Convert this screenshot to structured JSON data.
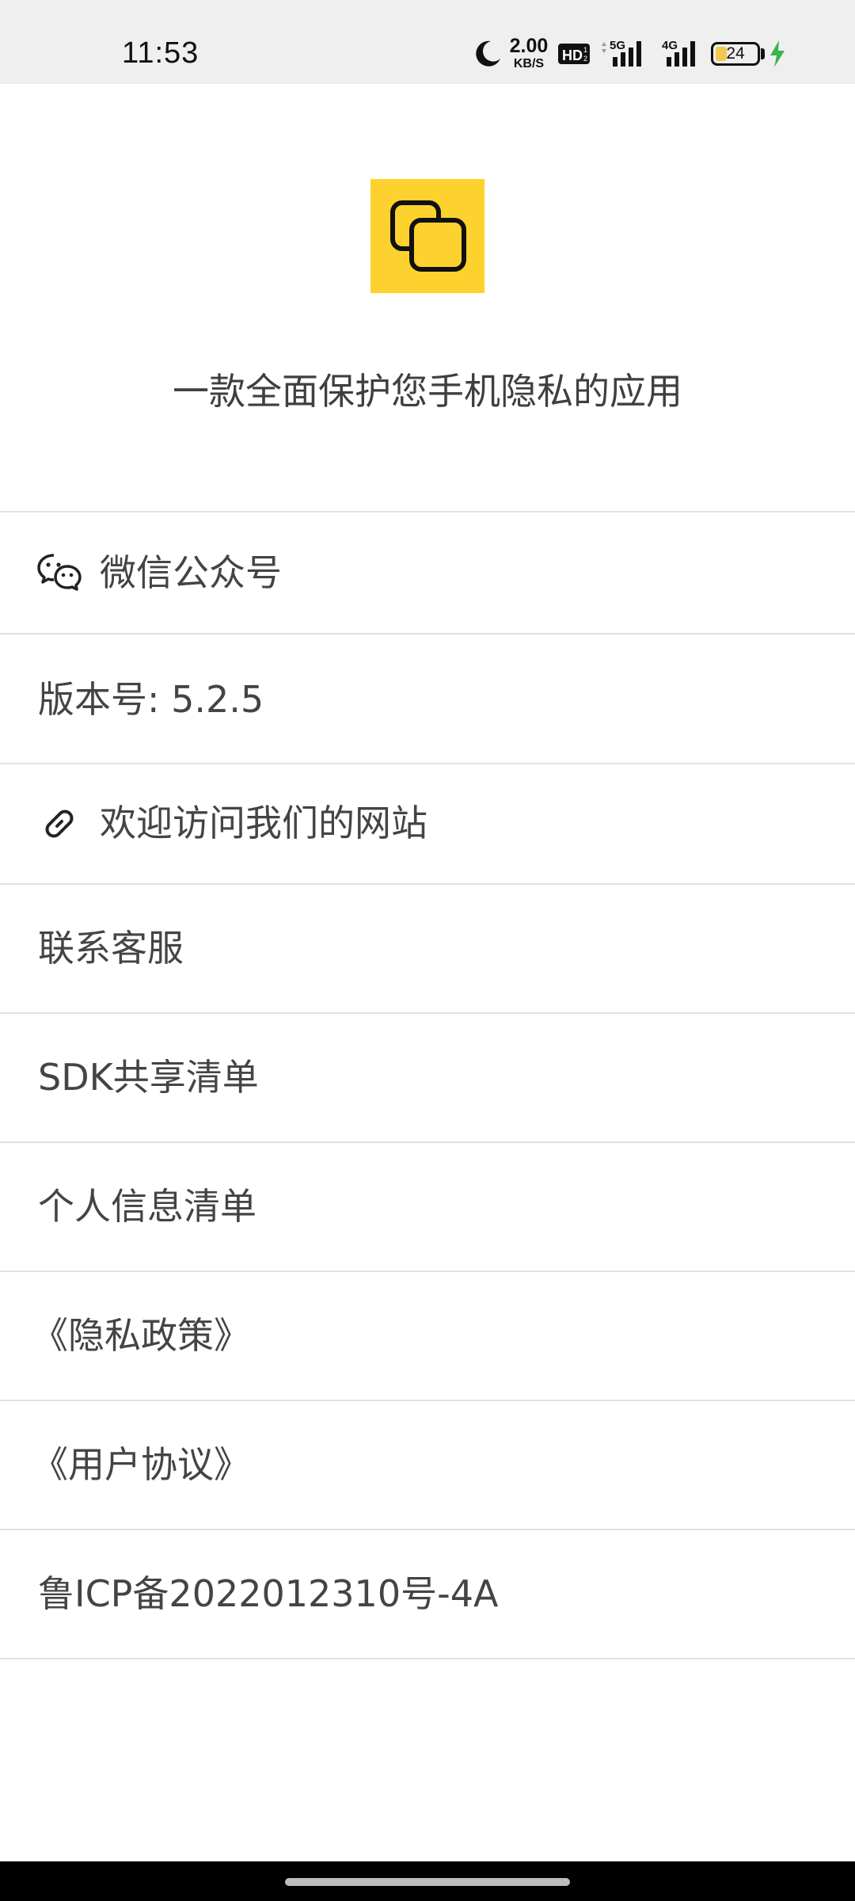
{
  "status_bar": {
    "time": "11:53",
    "net_speed_value": "2.00",
    "net_speed_unit": "KB/S",
    "hd_label": "HD",
    "network_1": "5G",
    "network_2": "4G",
    "battery_level": "24",
    "icons": [
      "moon-icon",
      "hd-icon",
      "signal-5g-icon",
      "signal-4g-icon",
      "battery-icon",
      "charging-bolt-icon"
    ]
  },
  "app": {
    "logo_color": "#fdd22e",
    "tagline": "一款全面保护您手机隐私的应用"
  },
  "menu": {
    "items": [
      {
        "label": "微信公众号",
        "icon": "wechat-icon"
      },
      {
        "label": "版本号: 5.2.5"
      },
      {
        "label": "欢迎访问我们的网站",
        "icon": "link-icon"
      },
      {
        "label": "联系客服"
      },
      {
        "label": "SDK共享清单"
      },
      {
        "label": "个人信息清单"
      },
      {
        "label": "《隐私政策》"
      },
      {
        "label": "《用户协议》"
      },
      {
        "label": "鲁ICP备2022012310号-4A"
      }
    ]
  }
}
